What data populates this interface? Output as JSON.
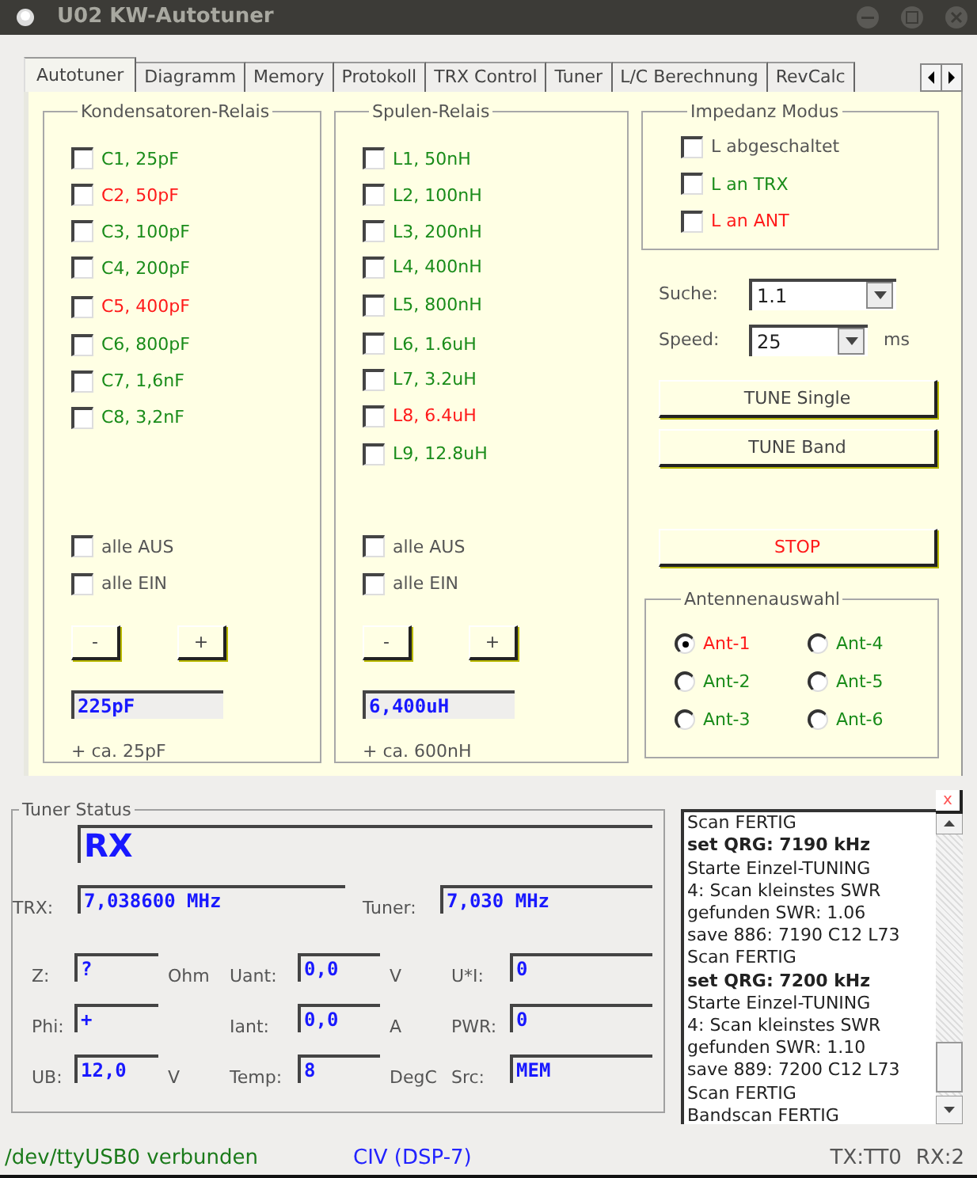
{
  "window": {
    "title": "U02 KW-Autotuner"
  },
  "tabs": [
    {
      "label": "Autotuner",
      "selected": true
    },
    {
      "label": "Diagramm",
      "selected": false
    },
    {
      "label": "Memory",
      "selected": false
    },
    {
      "label": "Protokoll",
      "selected": false
    },
    {
      "label": "TRX Control",
      "selected": false
    },
    {
      "label": "Tuner",
      "selected": false
    },
    {
      "label": "L/C Berechnung",
      "selected": false
    },
    {
      "label": "RevCalc",
      "selected": false
    }
  ],
  "relay_groups": [
    {
      "title": "Kondensatoren-Relais",
      "relays": [
        {
          "label": "C1, 25pF",
          "checked": false,
          "color": "#1a8c1a"
        },
        {
          "label": "C2, 50pF",
          "checked": false,
          "color": "#ff1a1a"
        },
        {
          "label": "C3, 100pF",
          "checked": false,
          "color": "#1a8c1a"
        },
        {
          "label": "C4, 200pF",
          "checked": false,
          "color": "#1a8c1a"
        },
        {
          "label": "C5, 400pF",
          "checked": false,
          "color": "#ff1a1a"
        },
        {
          "label": "C6, 800pF",
          "checked": false,
          "color": "#1a8c1a"
        },
        {
          "label": "C7, 1,6nF",
          "checked": false,
          "color": "#1a8c1a"
        },
        {
          "label": "C8, 3,2nF",
          "checked": false,
          "color": "#1a8c1a"
        }
      ],
      "all_off": {
        "label": "alle AUS",
        "checked": false
      },
      "all_on": {
        "label": "alle EIN",
        "checked": false
      },
      "minus": "-",
      "plus": "+",
      "value": "225pF",
      "note": "+ ca. 25pF"
    },
    {
      "title": "Spulen-Relais",
      "relays": [
        {
          "label": "L1, 50nH",
          "checked": false,
          "color": "#1a8c1a"
        },
        {
          "label": "L2, 100nH",
          "checked": false,
          "color": "#1a8c1a"
        },
        {
          "label": "L3, 200nH",
          "checked": false,
          "color": "#1a8c1a"
        },
        {
          "label": "L4, 400nH",
          "checked": false,
          "color": "#1a8c1a"
        },
        {
          "label": "L5, 800nH",
          "checked": false,
          "color": "#1a8c1a"
        },
        {
          "label": "L6, 1.6uH",
          "checked": false,
          "color": "#1a8c1a"
        },
        {
          "label": "L7, 3.2uH",
          "checked": false,
          "color": "#1a8c1a"
        },
        {
          "label": "L8, 6.4uH",
          "checked": false,
          "color": "#ff1a1a"
        },
        {
          "label": "L9, 12.8uH",
          "checked": false,
          "color": "#1a8c1a"
        }
      ],
      "all_off": {
        "label": "alle AUS",
        "checked": false
      },
      "all_on": {
        "label": "alle EIN",
        "checked": false
      },
      "minus": "-",
      "plus": "+",
      "value": "6,400uH",
      "note": "+ ca. 600nH"
    }
  ],
  "impedance_mode": {
    "title": "Impedanz Modus",
    "options": [
      {
        "label": "L abgeschaltet",
        "checked": false,
        "color": "#555555"
      },
      {
        "label": "L an TRX",
        "checked": false,
        "color": "#1a8c1a"
      },
      {
        "label": "L an ANT",
        "checked": false,
        "color": "#ff1a1a"
      }
    ]
  },
  "search": {
    "label": "Suche:",
    "value": "1.1"
  },
  "speed": {
    "label": "Speed:",
    "value": "25",
    "unit": "ms"
  },
  "buttons": [
    {
      "label": "TUNE Single",
      "kind": "normal"
    },
    {
      "label": "TUNE Band",
      "kind": "normal"
    },
    {
      "label": "STOP",
      "kind": "stop"
    }
  ],
  "antenna_selection": {
    "title": "Antennenauswahl",
    "options": [
      {
        "label": "Ant-1",
        "selected": true,
        "color": "#ff1a1a"
      },
      {
        "label": "Ant-4",
        "selected": false,
        "color": "#1a8c1a"
      },
      {
        "label": "Ant-2",
        "selected": false,
        "color": "#1a8c1a"
      },
      {
        "label": "Ant-5",
        "selected": false,
        "color": "#1a8c1a"
      },
      {
        "label": "Ant-3",
        "selected": false,
        "color": "#1a8c1a"
      },
      {
        "label": "Ant-6",
        "selected": false,
        "color": "#1a8c1a"
      }
    ]
  },
  "tuner_status": {
    "title": "Tuner Status",
    "mode": "RX",
    "trx": {
      "label": "TRX:",
      "value": "7,038600 MHz"
    },
    "tuner": {
      "label": "Tuner:",
      "value": "7,030 MHz"
    },
    "rows": [
      [
        {
          "label": "Z:",
          "value": "?",
          "unit": "Ohm"
        },
        {
          "label": "Uant:",
          "value": "0,0",
          "unit": "V"
        },
        {
          "label": "U*I:",
          "value": "0"
        }
      ],
      [
        {
          "label": "Phi:",
          "value": "+"
        },
        {
          "label": "Iant:",
          "value": "0,0",
          "unit": "A"
        },
        {
          "label": "PWR:",
          "value": "0"
        }
      ],
      [
        {
          "label": "UB:",
          "value": "12,0",
          "unit": "V"
        },
        {
          "label": "Temp:",
          "value": "8",
          "unit": "DegC"
        },
        {
          "label": "Src:",
          "value": "MEM"
        }
      ]
    ]
  },
  "log": {
    "close_label": "x",
    "lines": [
      {
        "text": "Scan FERTIG",
        "bold": false
      },
      {
        "text": "set QRG: 7190 kHz",
        "bold": true
      },
      {
        "text": "Starte Einzel-TUNING",
        "bold": false
      },
      {
        "text": "4: Scan kleinstes SWR",
        "bold": false
      },
      {
        "text": "gefunden SWR: 1.06",
        "bold": false
      },
      {
        "text": "save 886: 7190 C12 L73",
        "bold": false
      },
      {
        "text": "Scan FERTIG",
        "bold": false
      },
      {
        "text": "set QRG: 7200 kHz",
        "bold": true
      },
      {
        "text": "Starte Einzel-TUNING",
        "bold": false
      },
      {
        "text": "4: Scan kleinstes SWR",
        "bold": false
      },
      {
        "text": "gefunden SWR: 1.10",
        "bold": false
      },
      {
        "text": "save 889: 7200 C12 L73",
        "bold": false
      },
      {
        "text": "Scan FERTIG",
        "bold": false
      },
      {
        "text": "Bandscan FERTIG",
        "bold": false
      }
    ]
  },
  "status_bar": {
    "connection": "/dev/ttyUSB0 verbunden",
    "protocol": "CIV (DSP-7)",
    "tx": "TX:TT0",
    "rx": "RX:2"
  }
}
